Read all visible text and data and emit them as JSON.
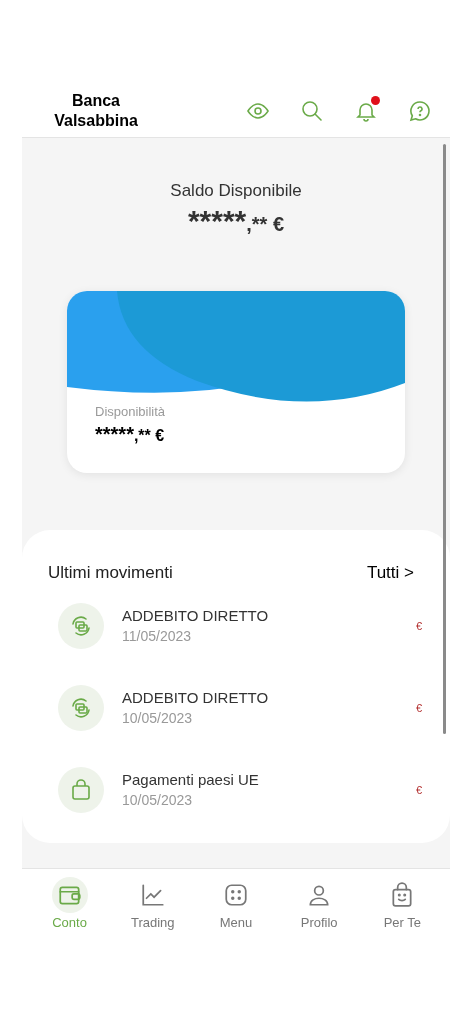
{
  "header": {
    "bank_name": "Banca Valsabbina",
    "notification_badge": true
  },
  "balance": {
    "label": "Saldo Disponibile",
    "amount_main": "*****",
    "amount_decimals": ",** €"
  },
  "account_card": {
    "label": "Disponibilità",
    "amount_main": "*****",
    "amount_decimals": ",** €"
  },
  "movements": {
    "title": "Ultimi movimenti",
    "all_link": "Tutti",
    "all_chevron": ">",
    "items": [
      {
        "kind": "direct_debit",
        "title": "ADDEBITO DIRETTO",
        "date": "11/05/2023",
        "amount": "€"
      },
      {
        "kind": "direct_debit",
        "title": "ADDEBITO DIRETTO",
        "date": "10/05/2023",
        "amount": "€"
      },
      {
        "kind": "shopping",
        "title": "Pagamenti paesi UE",
        "date": "10/05/2023",
        "amount": "€"
      }
    ]
  },
  "tab_bar": [
    {
      "kind": "account",
      "label": "Conto",
      "selected": true
    },
    {
      "kind": "trading",
      "label": "Trading",
      "selected": false
    },
    {
      "kind": "menu",
      "label": "Menu",
      "selected": false
    },
    {
      "kind": "profile",
      "label": "Profilo",
      "selected": false
    },
    {
      "kind": "for_you",
      "label": "Per Te",
      "selected": false
    }
  ]
}
